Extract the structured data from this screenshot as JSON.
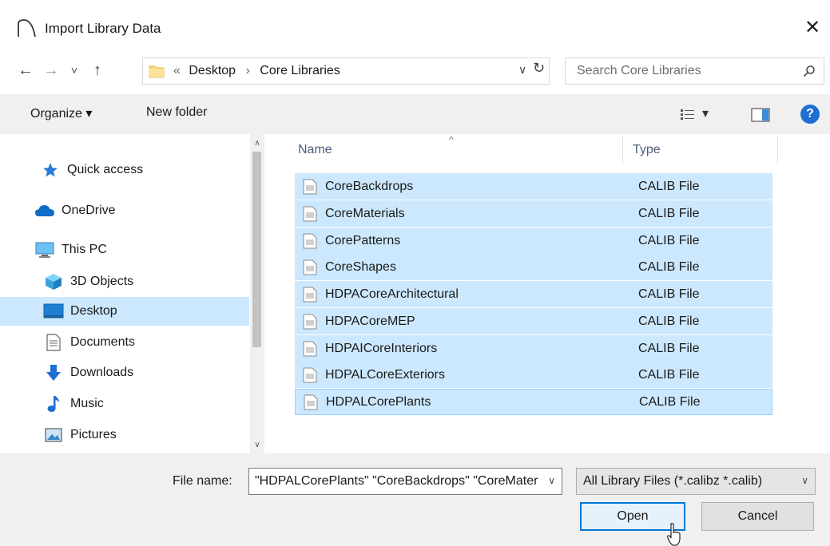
{
  "window": {
    "title": "Import Library Data",
    "close": "✕"
  },
  "address": {
    "back": "←",
    "forward": "→",
    "recent": "˅",
    "up": "↑",
    "overflow": "«",
    "crumbs": [
      "Desktop",
      "Core Libraries"
    ],
    "separator": "›",
    "dropdown": "∨",
    "refresh": "↻",
    "search_placeholder": "Search Core Libraries"
  },
  "toolbar": {
    "organize_label": "Organize ▾",
    "new_folder_label": "New folder",
    "view_label": "▾",
    "help_label": "?"
  },
  "nav": {
    "items": [
      {
        "label": "Quick access",
        "icon": "star-icon"
      },
      {
        "label": "OneDrive",
        "icon": "cloud-icon"
      },
      {
        "label": "This PC",
        "icon": "monitor-icon"
      },
      {
        "label": "3D Objects",
        "icon": "cube-icon"
      },
      {
        "label": "Desktop",
        "icon": "desktop-icon",
        "selected": true
      },
      {
        "label": "Documents",
        "icon": "document-icon"
      },
      {
        "label": "Downloads",
        "icon": "download-arrow-icon"
      },
      {
        "label": "Music",
        "icon": "music-note-icon"
      },
      {
        "label": "Pictures",
        "icon": "picture-icon"
      }
    ],
    "scroll_up": "∧",
    "scroll_down": "∨"
  },
  "files": {
    "columns": {
      "name": "Name",
      "type": "Type"
    },
    "sort_caret": "^",
    "rows": [
      {
        "name": "CoreBackdrops",
        "type": "CALIB File"
      },
      {
        "name": "CoreMaterials",
        "type": "CALIB File"
      },
      {
        "name": "CorePatterns",
        "type": "CALIB File"
      },
      {
        "name": "CoreShapes",
        "type": "CALIB File"
      },
      {
        "name": "HDPACoreArchitectural",
        "type": "CALIB File"
      },
      {
        "name": "HDPACoreMEP",
        "type": "CALIB File"
      },
      {
        "name": "HDPAICoreInteriors",
        "type": "CALIB File"
      },
      {
        "name": "HDPALCoreExteriors",
        "type": "CALIB File"
      },
      {
        "name": "HDPALCorePlants",
        "type": "CALIB File"
      }
    ]
  },
  "bottom": {
    "file_name_label": "File name:",
    "file_name_value": "\"HDPALCorePlants\" \"CoreBackdrops\" \"CoreMaterials\" \"CorePatterns\" \"CoreShapes\"",
    "file_name_dd": "∨",
    "filter_value": "All Library Files (*.calibz *.calib)",
    "filter_dd": "∨",
    "open_label": "Open",
    "cancel_label": "Cancel"
  },
  "colors": {
    "selection": "#cce8ff",
    "accent": "#0078d7",
    "help": "#1e6fd0"
  }
}
